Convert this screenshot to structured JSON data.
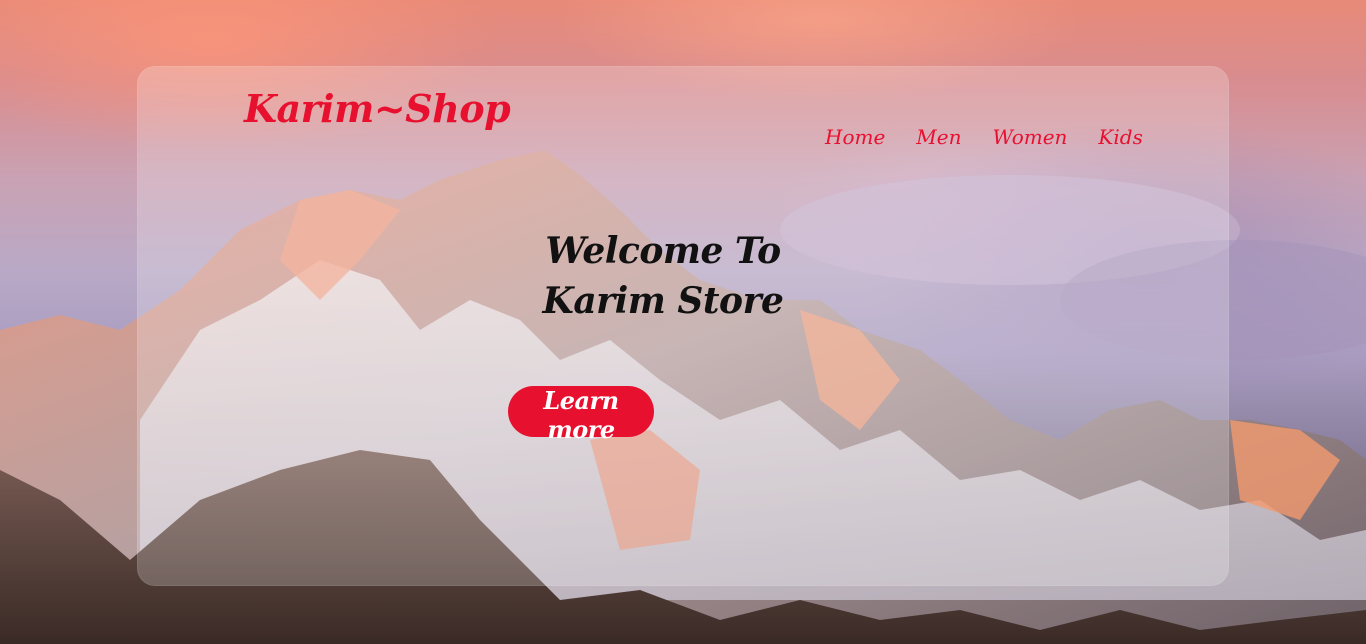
{
  "header": {
    "logo_text": "Karim~Shop",
    "nav": [
      {
        "label": "Home"
      },
      {
        "label": "Men"
      },
      {
        "label": "Women"
      },
      {
        "label": "Kids"
      }
    ]
  },
  "hero": {
    "title_line_1": "Welcome To",
    "title_line_2": "Karim Store",
    "cta_label": "Learn more"
  },
  "colors": {
    "accent": "#e8102f",
    "title": "#111111"
  }
}
